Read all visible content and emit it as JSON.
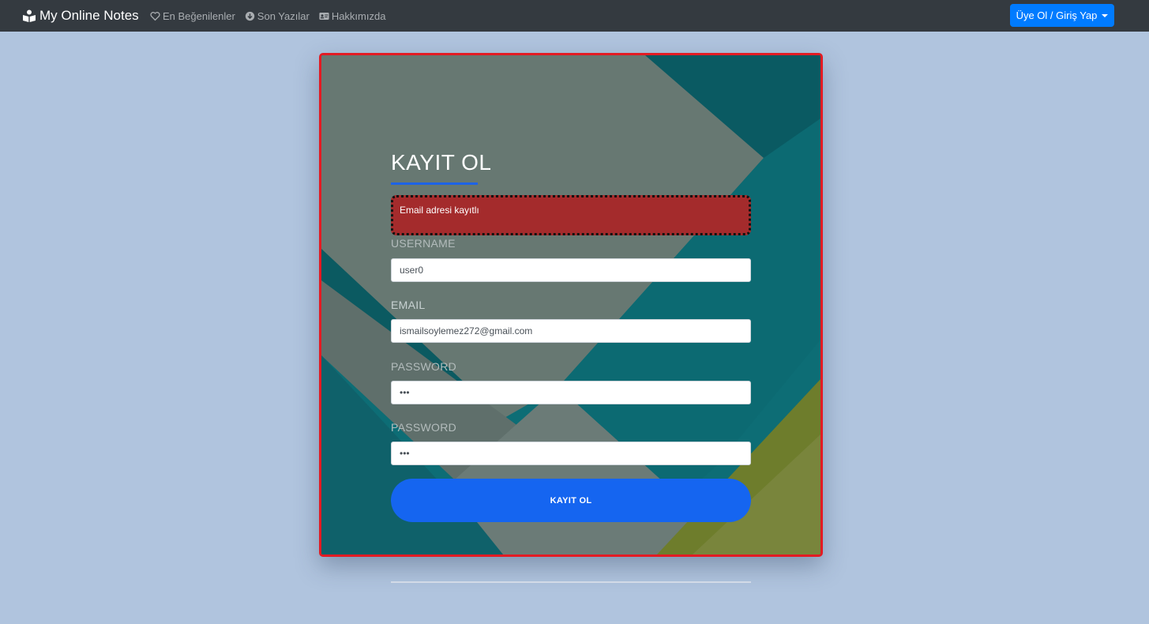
{
  "navbar": {
    "brand": "My Online Notes",
    "links": [
      {
        "label": "En Beğenilenler",
        "icon": "heart-icon"
      },
      {
        "label": "Son Yazılar",
        "icon": "arrow-down-circle-icon"
      },
      {
        "label": "Hakkımızda",
        "icon": "id-card-icon"
      }
    ],
    "dropdown_label": "Üye Ol / Giriş Yap"
  },
  "form": {
    "title": "KAYIT OL",
    "alert": "Email adresi kayıtlı",
    "username_label": "USERNAME",
    "username_value": "user0",
    "email_label": "EMAIL",
    "email_value": "ismailsoylemez272@gmail.com",
    "password_label": "PASSWORD",
    "password_value": "•••",
    "password_confirm_label": "PASSWORD",
    "password_confirm_value": "•••",
    "submit_label": "KAYIT OL"
  },
  "colors": {
    "page_background": "#b0c4de",
    "navbar": "#343a40",
    "accent": "#007bff",
    "card_border": "#e31b23",
    "alert_background": "#a42b2c",
    "submit_button": "#1565f0"
  }
}
